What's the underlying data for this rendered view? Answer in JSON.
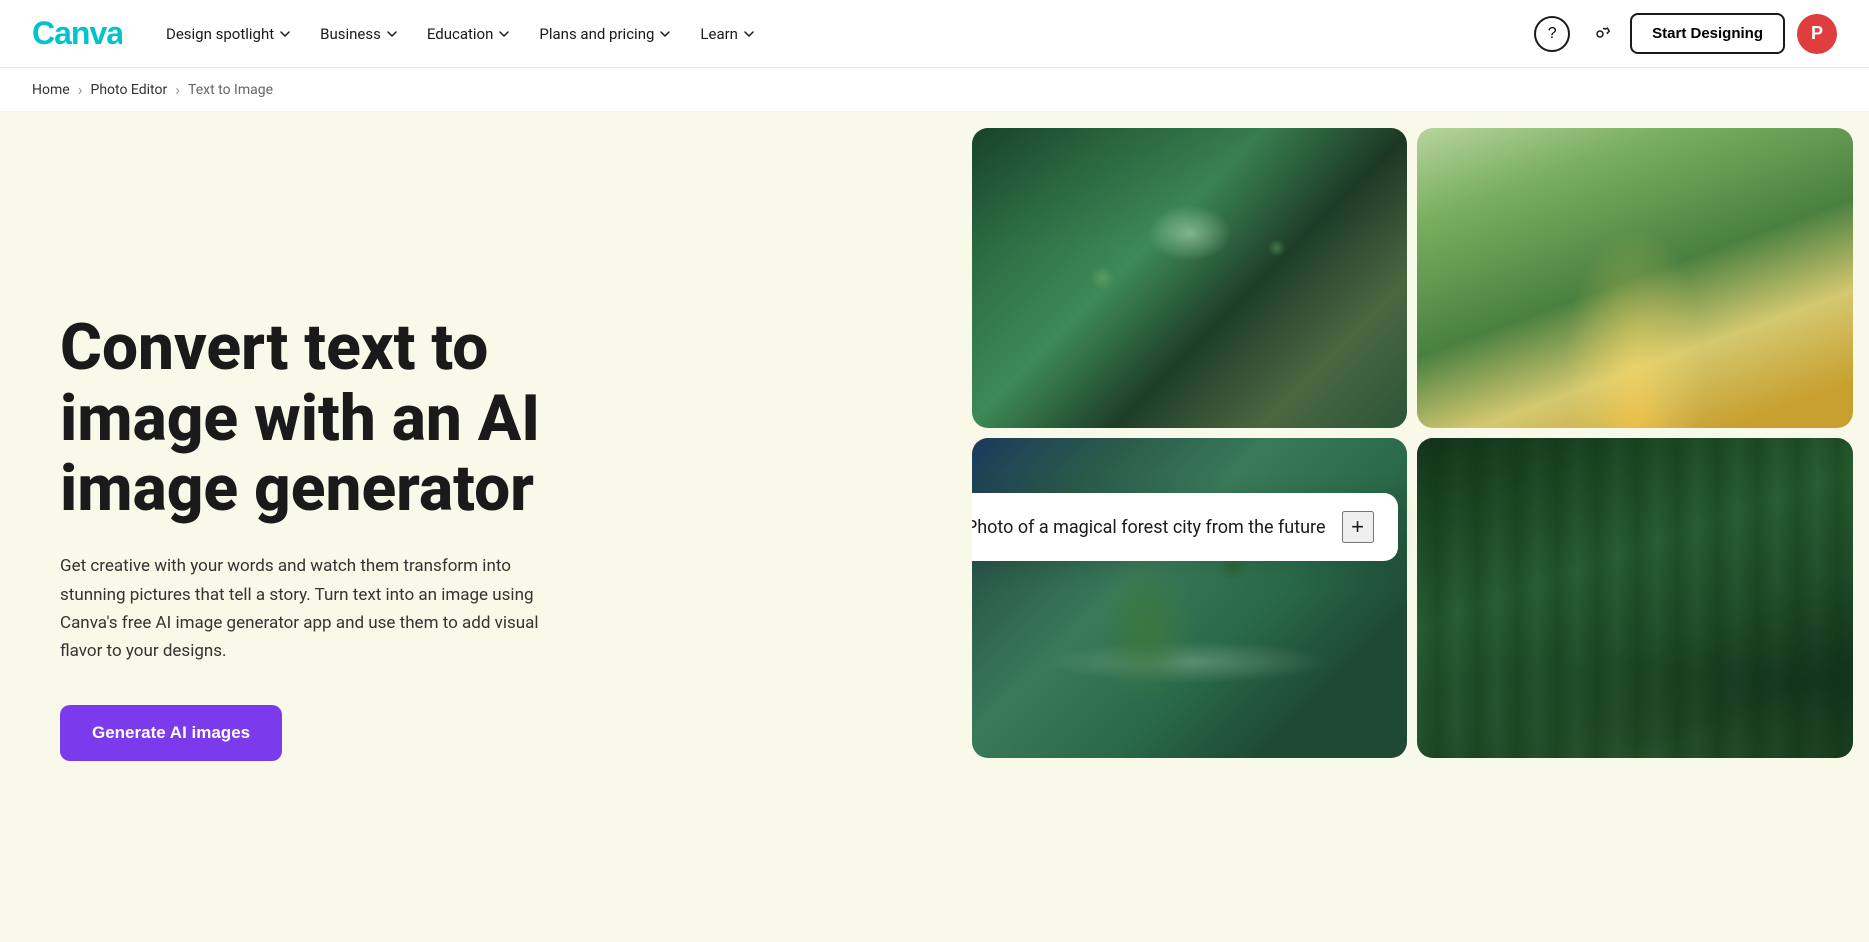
{
  "nav": {
    "logo_text": "Canva",
    "links": [
      {
        "label": "Design spotlight",
        "has_dropdown": true
      },
      {
        "label": "Business",
        "has_dropdown": true
      },
      {
        "label": "Education",
        "has_dropdown": true
      },
      {
        "label": "Plans and pricing",
        "has_dropdown": true
      },
      {
        "label": "Learn",
        "has_dropdown": true
      }
    ],
    "help_icon": "?",
    "gear_icon": "⚙",
    "start_btn": "Start Designing",
    "avatar_letter": "P"
  },
  "breadcrumb": {
    "home": "Home",
    "photo_editor": "Photo Editor",
    "current": "Text to Image"
  },
  "hero": {
    "title": "Convert text to image with an AI image generator",
    "description": "Get creative with your words and watch them transform into stunning pictures that tell a story. Turn text into an image using Canva's free AI image generator app and use them to add visual flavor to your designs.",
    "cta_label": "Generate AI images"
  },
  "prompt": {
    "text": "Photo of a magical forest city from the future",
    "plus_icon": "+"
  },
  "images": [
    {
      "alt": "Aerial view of futuristic forest city",
      "position": "top-left"
    },
    {
      "alt": "Enchanted forest path with golden light",
      "position": "top-right"
    },
    {
      "alt": "Aerial winding road through forest",
      "position": "bottom-left"
    },
    {
      "alt": "Ancient tall trees in mystical forest",
      "position": "bottom-right"
    }
  ]
}
